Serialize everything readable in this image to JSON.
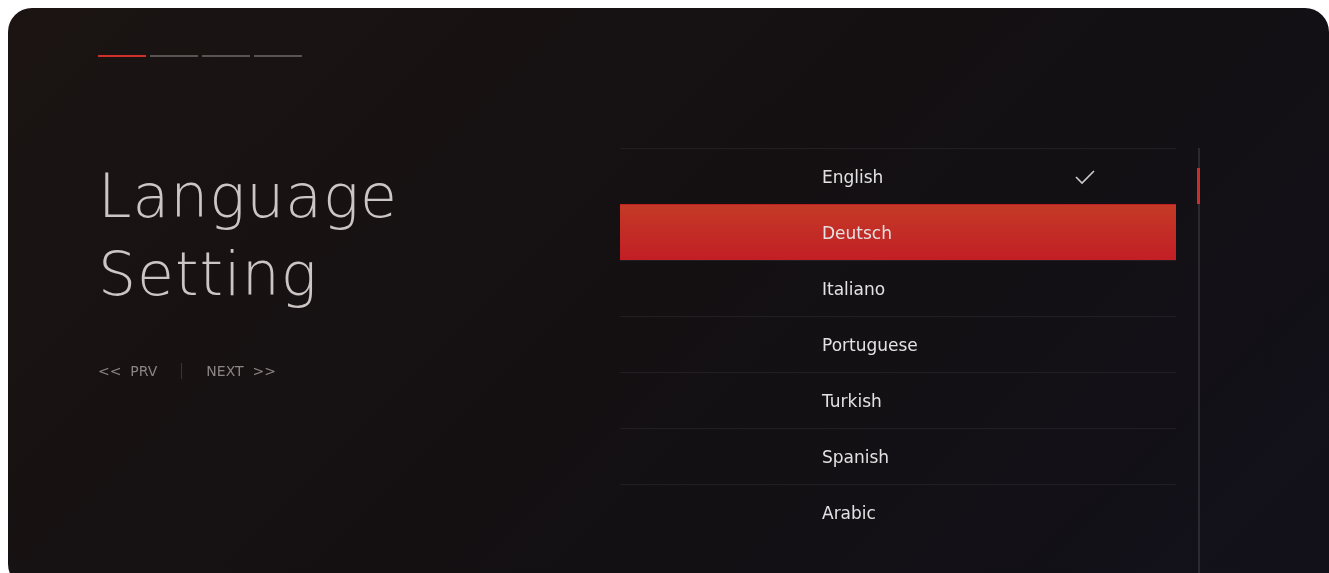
{
  "steps": [
    {
      "selected": true
    },
    {
      "selected": false
    },
    {
      "selected": false
    },
    {
      "selected": false
    }
  ],
  "title": "Language Setting",
  "nav": {
    "prev": "<<  PRV",
    "next": "NEXT  >>"
  },
  "languages": [
    {
      "label": "English",
      "selected": false,
      "checked": true
    },
    {
      "label": "Deutsch",
      "selected": true,
      "checked": false
    },
    {
      "label": "Italiano",
      "selected": false,
      "checked": false
    },
    {
      "label": "Portuguese",
      "selected": false,
      "checked": false
    },
    {
      "label": "Turkish",
      "selected": false,
      "checked": false
    },
    {
      "label": "Spanish",
      "selected": false,
      "checked": false
    },
    {
      "label": "Arabic",
      "selected": false,
      "checked": false
    }
  ]
}
